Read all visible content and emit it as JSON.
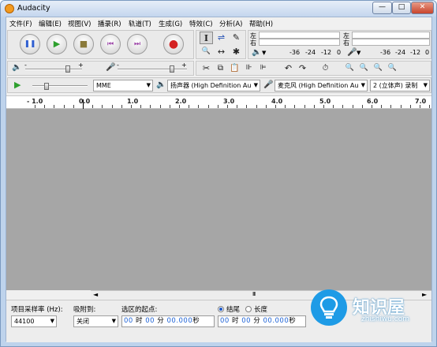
{
  "window": {
    "title": "Audacity",
    "minimize": "—",
    "maximize": "□",
    "close": "✕"
  },
  "menu": [
    "文件(F)",
    "编辑(E)",
    "视图(V)",
    "播录(R)",
    "轨道(T)",
    "生成(G)",
    "特效(C)",
    "分析(A)",
    "帮助(H)"
  ],
  "transport": {
    "pause": "❚❚",
    "play": "▶",
    "stop": "■",
    "skip_start": "⏮",
    "skip_end": "⏭",
    "record": "●"
  },
  "tools": {
    "select": "I",
    "envelope": "⇌",
    "draw": "✎",
    "zoom": "🔍",
    "timeshift": "↔",
    "multi": "✱"
  },
  "meters": {
    "left": "左",
    "right": "右",
    "scale": [
      "-36",
      "-24",
      "-12",
      "0"
    ]
  },
  "mixer": {
    "minus": "-",
    "plus": "+",
    "output_volume": 0.75,
    "input_volume": 0.78
  },
  "device": {
    "host": "MME",
    "output": "扬声器 (High Definition Au",
    "input": "麦克风 (High Definition Au",
    "channels": "2 (立体声) 录制"
  },
  "play_speed": 0.25,
  "ruler": {
    "ticks": [
      "- 1.0",
      "0.0",
      "1.0",
      "2.0",
      "3.0",
      "4.0",
      "5.0",
      "6.0",
      "7.0"
    ]
  },
  "scroll": {
    "grip": "III"
  },
  "bottom": {
    "rate_label": "项目采样率 (Hz):",
    "rate_value": "44100",
    "snap_label": "吸附到:",
    "snap_value": "关闭",
    "selection_start_label": "选区的起点:",
    "end_label": "结尾",
    "length_label": "长度",
    "time_start": {
      "h": "00",
      "h_unit": "时",
      "m": "00",
      "m_unit": "分",
      "s": "00.000",
      "s_unit": "秒"
    },
    "time_end": {
      "h": "00",
      "h_unit": "时",
      "m": "00",
      "m_unit": "分",
      "s": "00.000",
      "s_unit": "秒"
    }
  },
  "watermark": {
    "cn": "知识屋",
    "en": "zhishiwu.com"
  },
  "colors": {
    "play_green": "#2ea02e",
    "record_red": "#d42121",
    "pause_blue": "#2f5fd1",
    "track_bg": "#a6a6a6"
  }
}
